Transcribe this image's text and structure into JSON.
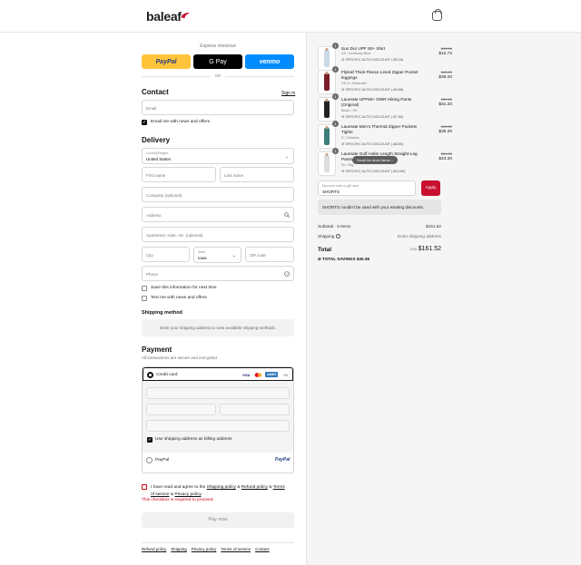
{
  "header": {
    "logo": "baleaf"
  },
  "express": {
    "title": "Express checkout",
    "paypal": "PayPal",
    "gpay": "G Pay",
    "venmo": "venmo",
    "or": "OR"
  },
  "contact": {
    "title": "Contact",
    "signin": "Sign in",
    "email_placeholder": "Email",
    "news_label": "Email me with news and offers"
  },
  "delivery": {
    "title": "Delivery",
    "country_label": "Country/Region",
    "country_value": "United States",
    "first_name": "First name",
    "last_name": "Last name",
    "company": "Company (optional)",
    "address": "Address",
    "apartment": "Apartment, suite, etc. (optional)",
    "city": "City",
    "state_label": "State",
    "state_value": "Iowa",
    "zip": "ZIP code",
    "phone": "Phone",
    "save_info": "Save this information for next time",
    "text_me": "Text me with news and offers"
  },
  "shipping_method": {
    "title": "Shipping method",
    "message": "Enter your shipping address to view available shipping methods."
  },
  "payment": {
    "title": "Payment",
    "subtitle": "All transactions are secure and encrypted.",
    "credit_card": "Credit card",
    "visa": "VISA",
    "amex": "AMEX",
    "more": "+3",
    "billing_same": "Use shipping address as billing address",
    "paypal_option": "PayPal",
    "paypal_logo": "PayPal"
  },
  "agree": {
    "prefix": "I have read and agree to the",
    "shipping_policy": "Shipping policy",
    "amp1": "&",
    "refund_policy": "Refund policy",
    "amp2": "&",
    "terms": "Terms of service",
    "amp3": "&",
    "privacy": "Privacy policy",
    "end": ".",
    "error": "This checkbox is required to proceed."
  },
  "pay_now": "Pay now",
  "footer_links": [
    "Refund policy",
    "Shipping",
    "Privacy policy",
    "Terms of service",
    "Contact"
  ],
  "cart": {
    "items": [
      {
        "qty": "1",
        "name": "Sun Dur UPF 50+ Shirt",
        "variant": "XS / Kentucky Blue",
        "discount": "SPECIFIC AUTO DISCOUNT (-$5.16)",
        "original": "$19.99",
        "price": "$12.72",
        "color": "#c9d9e6"
      },
      {
        "qty": "1",
        "name": "Flyleaf Thick Fleece Lined Zipper Pocket leggings",
        "variant": "XS-S / Zinfandel",
        "discount": "SPECIFIC AUTO DISCOUNT (-$9.86)",
        "original": "$49.09",
        "price": "$39.20",
        "color": "#7a1f2a"
      },
      {
        "qty": "1",
        "name": "Laureate UPF50+ DWR Hiking Pants (Original)",
        "variant": "Black / XS",
        "discount": "SPECIFIC AUTO DISCOUNT (-$7.80)",
        "original": "$39.00",
        "price": "$31.20",
        "color": "#222222"
      },
      {
        "qty": "1",
        "name": "Laureate Men's Thermal Zipper Pockets Tights",
        "variant": "S / Celadon",
        "discount": "SPECIFIC AUTO DISCOUNT (-$8.80)",
        "original": "$44.00",
        "price": "$35.20",
        "color": "#3a7f78"
      },
      {
        "qty": "1",
        "name": "Laureate Golf Ankle Length Straight-Leg Pants",
        "variant": "XL / Hig",
        "discount": "SPECIFIC AUTO DISCOUNT (-$10.80)",
        "original": "$54.00",
        "price": "$43.20",
        "color": "#dcdcdc"
      }
    ],
    "scroll_hint": "Scroll for more items",
    "discount_label": "Discount code or gift card",
    "discount_value": "SHORTS",
    "apply": "Apply",
    "discount_error": "SHORTS couldn't be used with your existing discounts.",
    "subtotal_label": "Subtotal · 5 items",
    "subtotal_value": "$161.52",
    "shipping_label": "Shipping",
    "shipping_value": "Enter shipping address",
    "total_label": "Total",
    "total_currency": "USD",
    "total_value": "$161.52",
    "savings_label": "TOTAL SAVINGS",
    "savings_value": "$40.38"
  }
}
